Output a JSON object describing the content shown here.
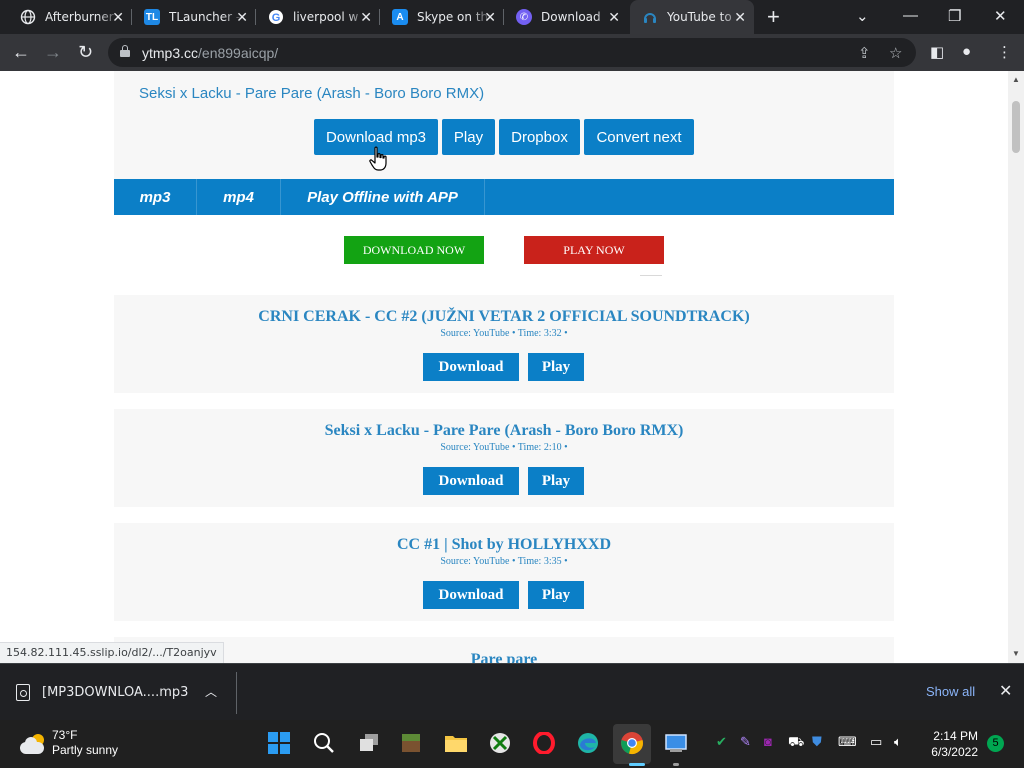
{
  "browser": {
    "tabs": [
      {
        "title": "Afterburner",
        "icon": "globe-icon"
      },
      {
        "title": "TLauncher -",
        "icon": "tlauncher-icon"
      },
      {
        "title": "liverpool w",
        "icon": "google-icon"
      },
      {
        "title": "Skype on th",
        "icon": "appstore-icon"
      },
      {
        "title": "Download",
        "icon": "viber-icon"
      },
      {
        "title": "YouTube to",
        "icon": "ytmp3-icon"
      }
    ],
    "url_host": "ytmp3.cc",
    "url_path": "/en899aicqp/"
  },
  "page": {
    "current_song": "Seksi x Lacku - Pare Pare (Arash - Boro Boro RMX)",
    "actions": {
      "download_mp3": "Download mp3",
      "play": "Play",
      "dropbox": "Dropbox",
      "convert_next": "Convert next"
    },
    "format_tabs": {
      "mp3": "mp3",
      "mp4": "mp4",
      "app": "Play Offline with APP"
    },
    "promo": {
      "download_now": "DOWNLOAD NOW",
      "play_now": "PLAY NOW"
    },
    "results": [
      {
        "title": "CRNI CERAK - CC #2 (JUŽNI VETAR 2 OFFICIAL SOUNDTRACK)",
        "meta": "Source: YouTube • Time: 3:32 •",
        "download": "Download",
        "play": "Play"
      },
      {
        "title": "Seksi x Lacku - Pare Pare (Arash - Boro Boro RMX)",
        "meta": "Source: YouTube • Time: 2:10 •",
        "download": "Download",
        "play": "Play"
      },
      {
        "title": "CC #1 | Shot by HOLLYHXXD",
        "meta": "Source: YouTube • Time: 3:35 •",
        "download": "Download",
        "play": "Play"
      },
      {
        "title": "Pare pare"
      }
    ],
    "status_url": "154.82.111.45.sslip.io/dl2/.../T2oanjyv"
  },
  "downloads": {
    "file": "[MP3DOWNLOA....mp3",
    "show_all": "Show all"
  },
  "taskbar": {
    "temp": "73°F",
    "condition": "Partly sunny",
    "time": "2:14 PM",
    "date": "6/3/2022",
    "notifications": "5"
  },
  "colors": {
    "accent": "#0b7fc7",
    "title_blue": "#2a86c1",
    "download_now": "#13a313",
    "play_now": "#c9221b"
  }
}
